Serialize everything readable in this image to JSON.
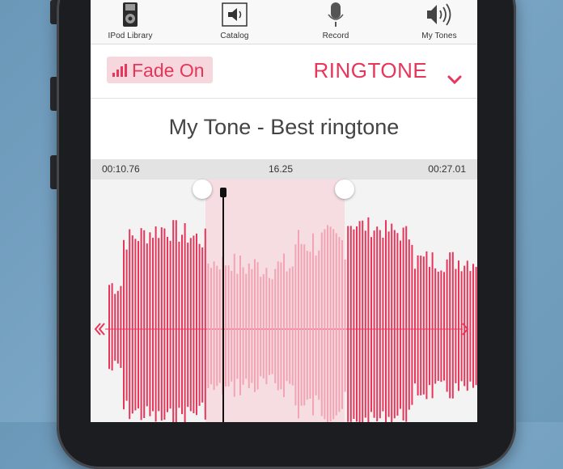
{
  "tabs": [
    {
      "label": "IPod Library",
      "icon": "ipod-icon"
    },
    {
      "label": "Catalog",
      "icon": "speaker-box-icon"
    },
    {
      "label": "Record",
      "icon": "microphone-icon"
    },
    {
      "label": "My Tones",
      "icon": "speaker-waves-icon"
    }
  ],
  "fade_label": "Fade On",
  "mode_label": "RINGTONE",
  "tone_title": "My Tone - Best ringtone",
  "times": {
    "start": "00:10.76",
    "current": "16.25",
    "end": "00:27.01"
  },
  "colors": {
    "accent": "#e8355a",
    "selection": "#f5dde2",
    "wave_faded": "#f3a4b4"
  }
}
